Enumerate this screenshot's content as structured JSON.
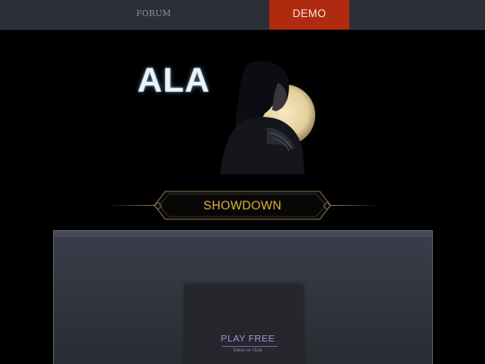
{
  "nav": {
    "forum_label": "FORUM",
    "demo_label": "DEMO"
  },
  "hero": {
    "logo_text": "ALA"
  },
  "banner": {
    "label": "SHOWDOWN"
  },
  "game": {
    "play_label": "PLAY FREE",
    "hint": "Enter or Click"
  },
  "colors": {
    "nav_bg": "#2c2f37",
    "demo_bg": "#b02a10",
    "banner_text": "#e0b437",
    "play_text": "#a790d8"
  }
}
